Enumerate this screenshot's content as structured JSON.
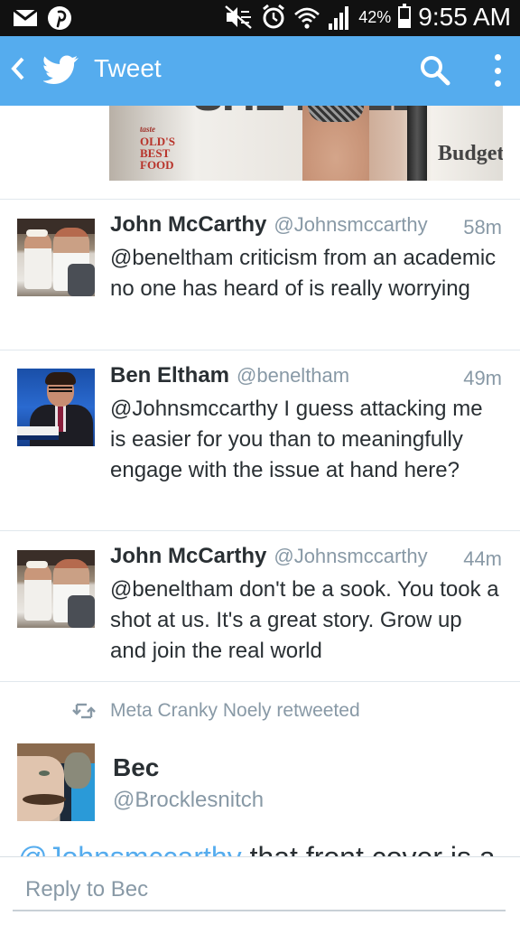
{
  "status_bar": {
    "battery": "42%",
    "battery_level": 0.42,
    "time": "9:55 AM",
    "icons": [
      "email-icon",
      "pinterest-icon",
      "mute-icon",
      "alarm-icon",
      "wifi-icon",
      "signal-icon",
      "battery-icon"
    ]
  },
  "action_bar": {
    "title": "Tweet",
    "color": "#55acee",
    "icons": [
      "back-chevron-icon",
      "twitter-bird-icon",
      "search-icon",
      "overflow-menu-icon"
    ]
  },
  "news_image": {
    "headline": "SHE MALE",
    "left_text": [
      "taste",
      "OLD'S",
      "BEST",
      "FOOD"
    ],
    "right_text": "Budget"
  },
  "tweets": [
    {
      "name": "John McCarthy",
      "handle": "@Johnsmccarthy",
      "time": "58m",
      "text": "@beneltham criticism from an academic no one has heard of is really worrying"
    },
    {
      "name": "Ben Eltham",
      "handle": "@beneltham",
      "time": "49m",
      "text": "@Johnsmccarthy I guess attacking me is easier for you than to meaningfully engage with the issue at hand here?"
    },
    {
      "name": "John McCarthy",
      "handle": "@Johnsmccarthy",
      "time": "44m",
      "text": "@beneltham don't be a sook. You took a shot at us. It's a great story. Grow up and join the real world"
    }
  ],
  "retweet": {
    "label": "Meta Cranky Noely retweeted"
  },
  "focus_tweet": {
    "name": "Bec",
    "handle": "@Brocklesnitch",
    "text_mention": "@Johnsmccarthy",
    "text_rest": " that front cover is a"
  },
  "reply": {
    "placeholder": "Reply to Bec"
  }
}
